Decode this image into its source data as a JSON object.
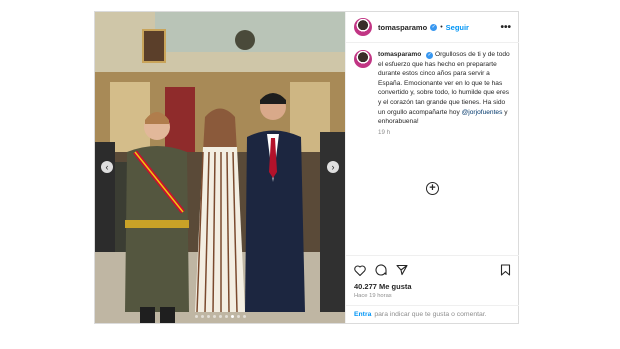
{
  "header": {
    "username": "tomasparamo",
    "separator": "•",
    "follow_label": "Seguir",
    "more_label": "•••"
  },
  "caption": {
    "username": "tomasparamo",
    "text": "Orgullosos de ti y de todo el esfuerzo que has hecho en prepararte durante estos cinco años para servir a España. Emocionante ver en lo que te has convertido y, sobre todo, lo humilde que eres y el corazón tan grande que tienes. Ha sido un orgullo acompañarte hoy",
    "mention": "@jorjofuentes",
    "text_end": " y enhorabuena!",
    "time": "19 h"
  },
  "actions": {
    "likes": "40.277 Me gusta",
    "ago": "Hace 19 horas"
  },
  "login": {
    "link": "Entra",
    "text": "para indicar que te gusta o comentar."
  },
  "carousel": {
    "prev": "‹",
    "next": "›",
    "slide_count": 9,
    "active_slide": 7
  },
  "colors": {
    "link": "#0095f6",
    "verified": "#3897f0",
    "muted": "#8e8e8e"
  }
}
